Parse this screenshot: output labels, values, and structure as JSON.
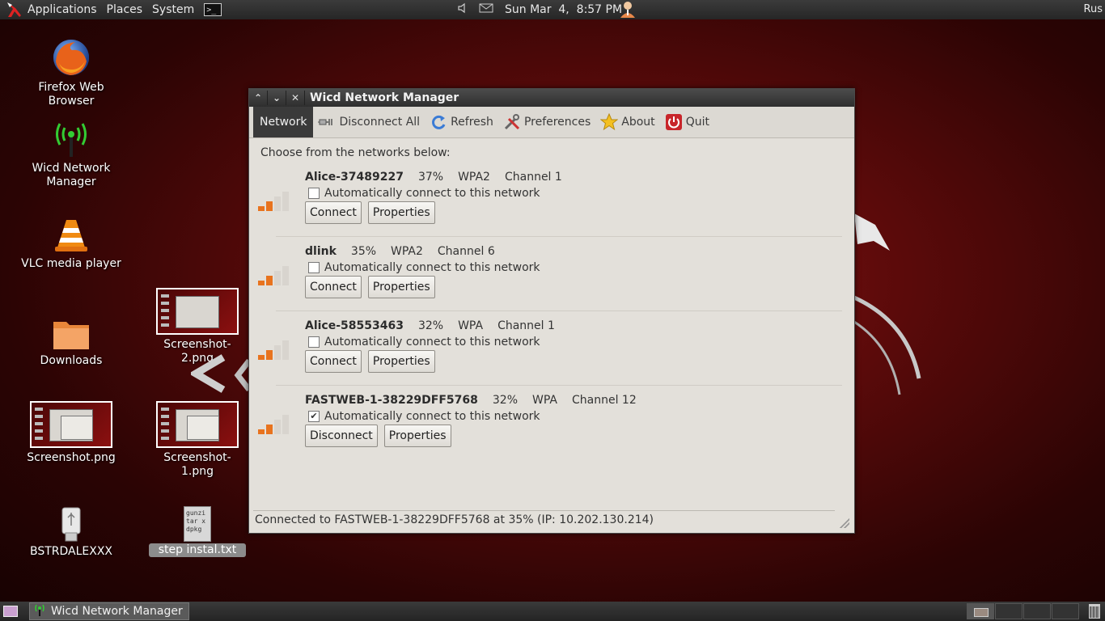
{
  "top_panel": {
    "menus": [
      "Applications",
      "Places",
      "System"
    ],
    "clock": "Sun Mar  4,  8:57 PM",
    "right_text": "Rus"
  },
  "desktop": {
    "icons": [
      {
        "label": "Firefox Web Browser"
      },
      {
        "label": "Wicd Network Manager"
      },
      {
        "label": "VLC media player"
      },
      {
        "label": "Downloads"
      },
      {
        "label": "Screenshot.png"
      },
      {
        "label": "BSTRDALEXXX"
      },
      {
        "label": "Screenshot-2.png"
      },
      {
        "label": "Screenshot-1.png"
      },
      {
        "label": "step instal.txt"
      }
    ],
    "txt_preview": [
      "gunzi",
      "tar x",
      "",
      "dpkg"
    ]
  },
  "window": {
    "title": "Wicd Network Manager",
    "toolbar": {
      "network": "Network",
      "disconnect_all": "Disconnect All",
      "refresh": "Refresh",
      "preferences": "Preferences",
      "about": "About",
      "quit": "Quit"
    },
    "choose_text": "Choose from the networks below:",
    "auto_label": "Automatically connect to this network",
    "connect_label": "Connect",
    "disconnect_label": "Disconnect",
    "properties_label": "Properties",
    "networks": [
      {
        "ssid": "Alice-37489227",
        "strength": "37%",
        "security": "WPA2",
        "channel": "Channel 1",
        "auto": false
      },
      {
        "ssid": "dlink",
        "strength": "35%",
        "security": "WPA2",
        "channel": "Channel 6",
        "auto": false
      },
      {
        "ssid": "Alice-58553463",
        "strength": "32%",
        "security": "WPA",
        "channel": "Channel 1",
        "auto": false
      },
      {
        "ssid": "FASTWEB-1-38229DFF5768",
        "strength": "32%",
        "security": "WPA",
        "channel": "Channel 12",
        "auto": true
      }
    ],
    "status": "Connected to FASTWEB-1-38229DFF5768 at 35% (IP: 10.202.130.214)"
  },
  "taskbar": {
    "task_label": "Wicd Network Manager"
  },
  "colors": {
    "signal_on": "#e8731e",
    "signal_off": "#d4d0ca",
    "quit_red": "#c8252a"
  }
}
